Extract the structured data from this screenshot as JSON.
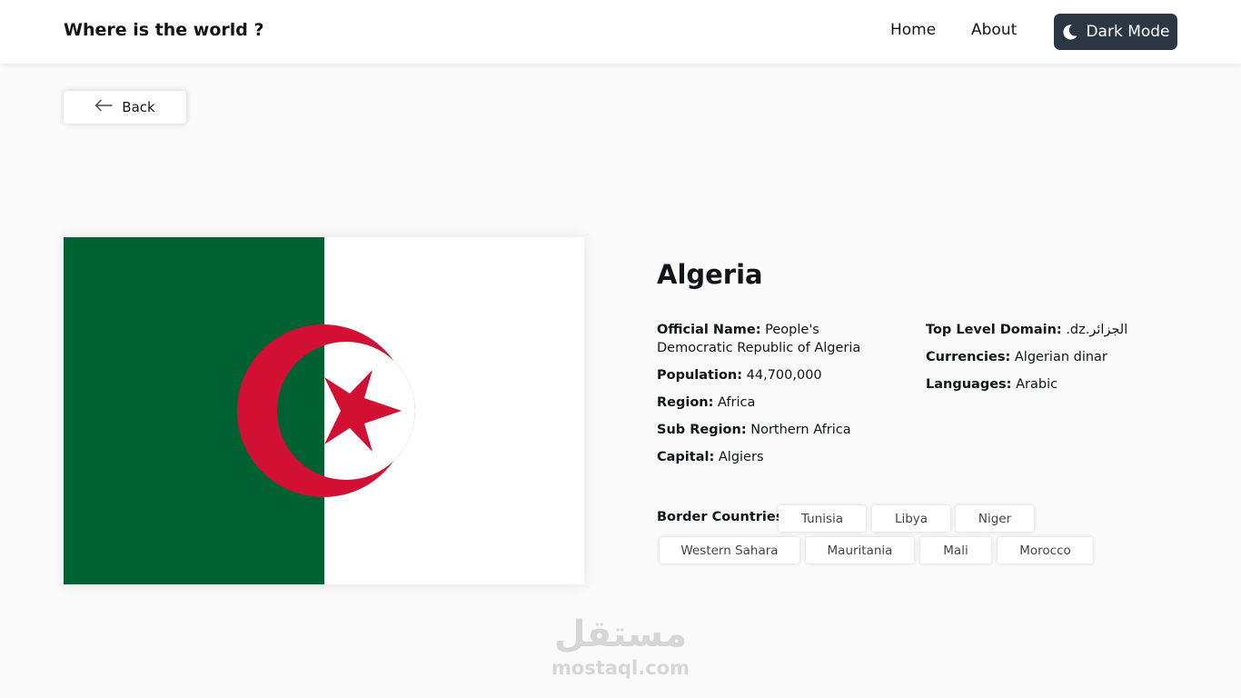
{
  "header": {
    "brand": "Where is the world ?",
    "nav": {
      "home": "Home",
      "about": "About"
    },
    "dark_mode_label": "Dark Mode"
  },
  "back_label": "Back",
  "country": {
    "name": "Algeria",
    "flag_colors": {
      "green": "#006233",
      "white": "#ffffff",
      "red": "#d21034"
    },
    "details_left": [
      {
        "label": "Official Name:",
        "value": "People's Democratic Republic of Algeria"
      },
      {
        "label": "Population:",
        "value": "44,700,000"
      },
      {
        "label": "Region:",
        "value": "Africa"
      },
      {
        "label": "Sub Region:",
        "value": "Northern Africa"
      },
      {
        "label": "Capital:",
        "value": "Algiers"
      }
    ],
    "details_right": [
      {
        "label": "Top Level Domain:",
        "value": ".dz.الجزائر"
      },
      {
        "label": "Currencies:",
        "value": "Algerian dinar"
      },
      {
        "label": "Languages:",
        "value": "Arabic"
      }
    ],
    "border_label": "Border Countries:",
    "borders": [
      "Tunisia",
      "Libya",
      "Niger",
      "Western Sahara",
      "Mauritania",
      "Mali",
      "Morocco"
    ]
  },
  "watermark": {
    "arabic": "مستقل",
    "latin": "mostaql.com"
  },
  "colors": {
    "dark_button": "#2b3743",
    "background": "#fafafa"
  }
}
